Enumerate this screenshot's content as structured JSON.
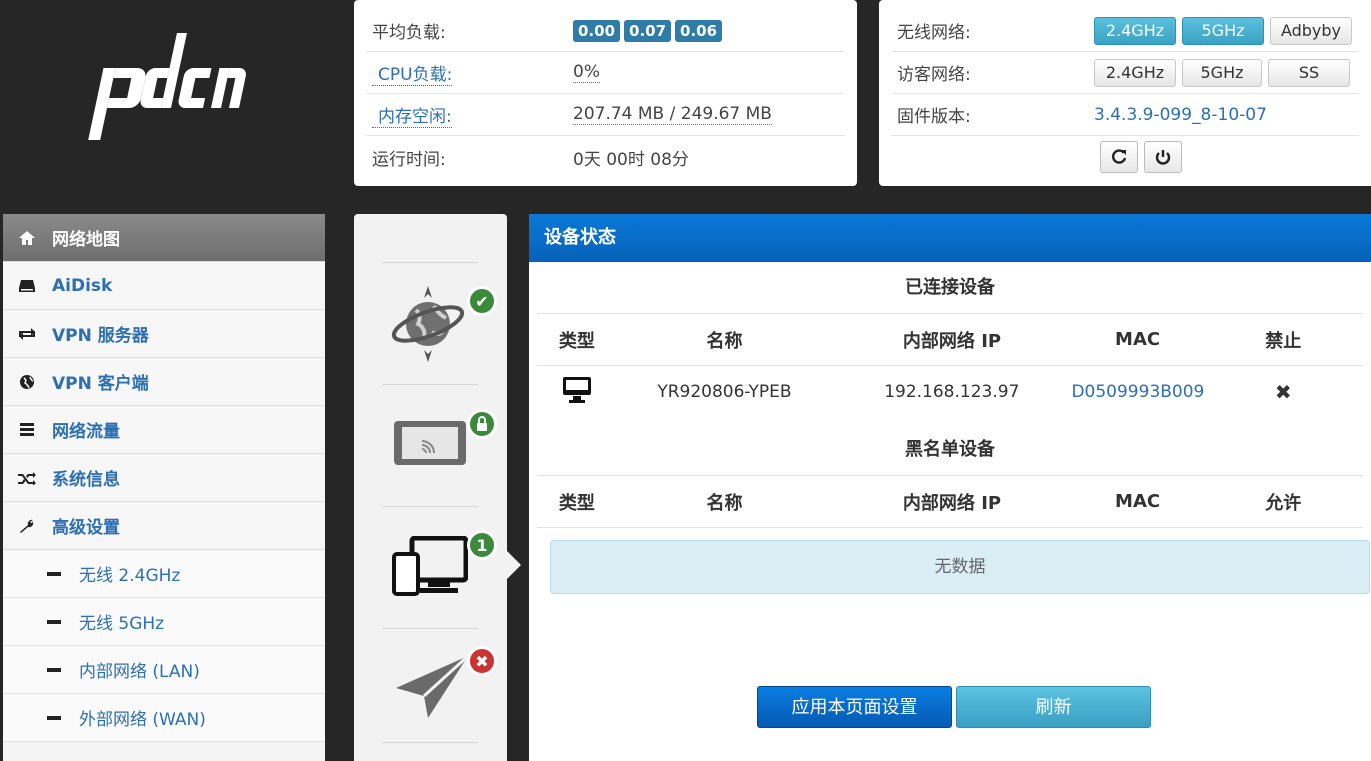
{
  "logo": {
    "text": "pdcn"
  },
  "load_panel": {
    "avg_load_label": "平均负载:",
    "load_values": [
      "0.00",
      "0.07",
      "0.06"
    ],
    "cpu_label": "CPU负载:",
    "cpu_value": "0%",
    "mem_label": "内存空闲:",
    "mem_value": "207.74 MB / 249.67 MB",
    "uptime_label": "运行时间:",
    "uptime_value": "0天 00时 08分"
  },
  "wifi_panel": {
    "wireless_label": "无线网络:",
    "wireless_buttons": [
      "2.4GHz",
      "5GHz",
      "Adbyby"
    ],
    "guest_label": "访客网络:",
    "guest_buttons": [
      "2.4GHz",
      "5GHz",
      "SS"
    ],
    "firmware_label": "固件版本:",
    "firmware_value": "3.4.3.9-099_8-10-07"
  },
  "sidebar": {
    "items": [
      {
        "label": "网络地图",
        "icon": "home-icon"
      },
      {
        "label": "AiDisk",
        "icon": "hdd-icon"
      },
      {
        "label": "VPN 服务器",
        "icon": "retweet-icon"
      },
      {
        "label": "VPN 客户端",
        "icon": "globe-icon"
      },
      {
        "label": "网络流量",
        "icon": "list-icon"
      },
      {
        "label": "系统信息",
        "icon": "random-icon"
      },
      {
        "label": "高级设置",
        "icon": "wrench-icon"
      }
    ],
    "subitems": [
      "无线 2.4GHz",
      "无线 5GHz",
      "内部网络 (LAN)",
      "外部网络 (WAN)"
    ]
  },
  "status_icons": {
    "internet": "check-icon",
    "wireless": "lock-icon",
    "clients": {
      "icon": "count-badge",
      "count": "1"
    },
    "usb": "x-icon"
  },
  "main": {
    "header": "设备状态",
    "connected_title": "已连接设备",
    "connected_columns": [
      "类型",
      "名称",
      "内部网络 IP",
      "MAC",
      "禁止"
    ],
    "connected_rows": [
      {
        "type_icon": "desktop-icon",
        "name": "YR920806-YPEB",
        "ip": "192.168.123.97",
        "mac": "D0509993B009",
        "action_icon": "close-icon"
      }
    ],
    "blacklist_title": "黑名单设备",
    "blacklist_columns": [
      "类型",
      "名称",
      "内部网络 IP",
      "MAC",
      "允许"
    ],
    "no_data": "无数据",
    "apply_button": "应用本页面设置",
    "refresh_button": "刷新"
  }
}
